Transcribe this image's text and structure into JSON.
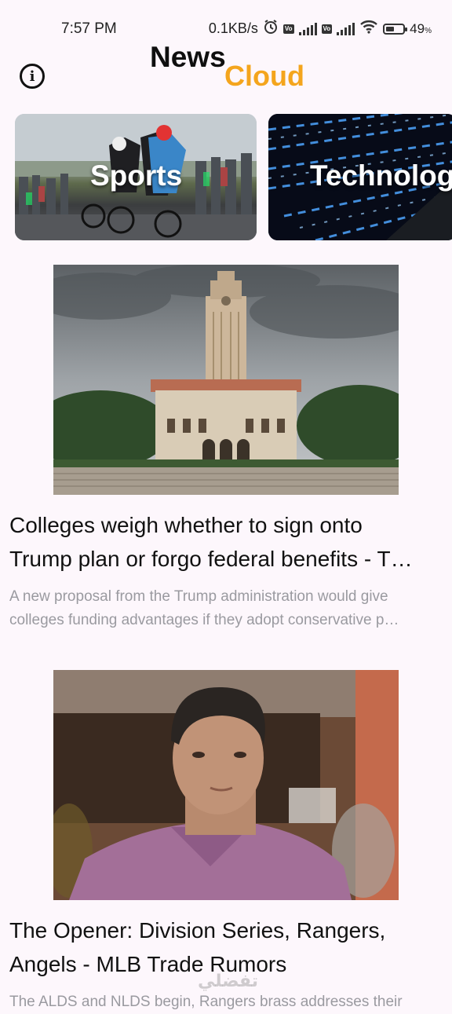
{
  "status_bar": {
    "time": "7:57 PM",
    "speed": "0.1KB/s",
    "lte1": "Vo\nLTE",
    "lte2": "Vo\nLTE",
    "battery_pct": "49",
    "battery_unit": "%",
    "battery_level": 0.49
  },
  "header": {
    "info_glyph": "i",
    "logo_news": "News",
    "logo_cloud": "Cloud",
    "accent_color": "#f4a51d"
  },
  "categories": [
    {
      "label": "Sports",
      "icon": "cyclists-photo"
    },
    {
      "label": "Technolog",
      "icon": "tech-lines-photo"
    }
  ],
  "articles": [
    {
      "image": "university-tower-photo",
      "title_line1": "Colleges weigh whether to sign onto",
      "title_line2": "Trump plan or forgo federal benefits - T…",
      "desc_line1": "A new proposal from the Trump administration would give",
      "desc_line2": "colleges funding advantages if they adopt conservative p…"
    },
    {
      "image": "man-portrait-photo",
      "title_line1": "The Opener: Division Series, Rangers,",
      "title_line2": "Angels - MLB Trade Rumors",
      "desc_line1": "The ALDS and NLDS begin, Rangers brass addresses their"
    }
  ],
  "watermark": "تفضلي"
}
